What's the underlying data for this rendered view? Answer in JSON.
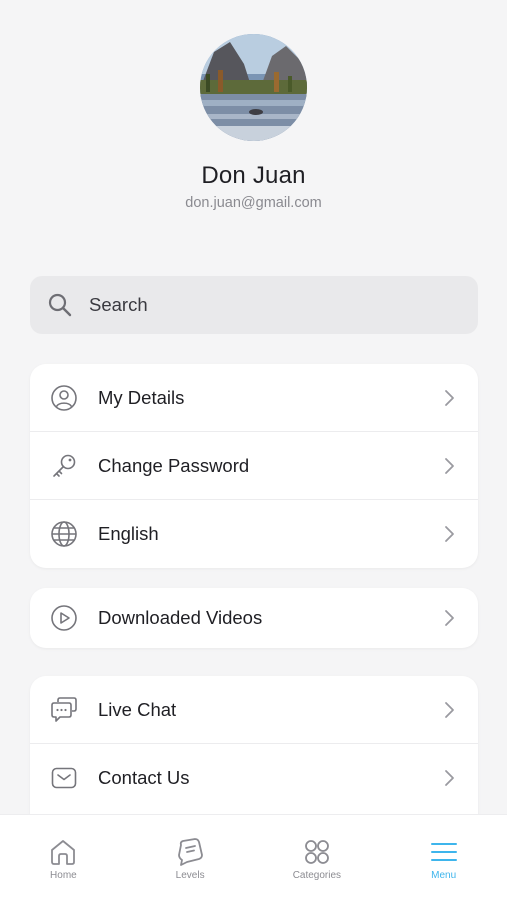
{
  "profile": {
    "name": "Don Juan",
    "email": "don.juan@gmail.com"
  },
  "search": {
    "placeholder": "Search"
  },
  "menu_groups": [
    {
      "items": [
        {
          "label": "My Details",
          "icon": "user-circle-icon"
        },
        {
          "label": "Change Password",
          "icon": "key-icon"
        },
        {
          "label": "English",
          "icon": "globe-icon"
        }
      ]
    },
    {
      "items": [
        {
          "label": "Downloaded Videos",
          "icon": "play-circle-icon"
        }
      ]
    },
    {
      "items": [
        {
          "label": "Live Chat",
          "icon": "chat-bubbles-icon"
        },
        {
          "label": "Contact Us",
          "icon": "mail-icon"
        }
      ]
    }
  ],
  "tabbar": {
    "tabs": [
      {
        "label": "Home",
        "icon": "home-icon"
      },
      {
        "label": "Levels",
        "icon": "levels-icon"
      },
      {
        "label": "Categories",
        "icon": "grid-icon"
      },
      {
        "label": "Menu",
        "icon": "menu-icon",
        "active": true
      }
    ]
  },
  "colors": {
    "accent": "#3eb5ec",
    "background": "#f5f5f6",
    "icon_gray": "#8c8c92"
  }
}
